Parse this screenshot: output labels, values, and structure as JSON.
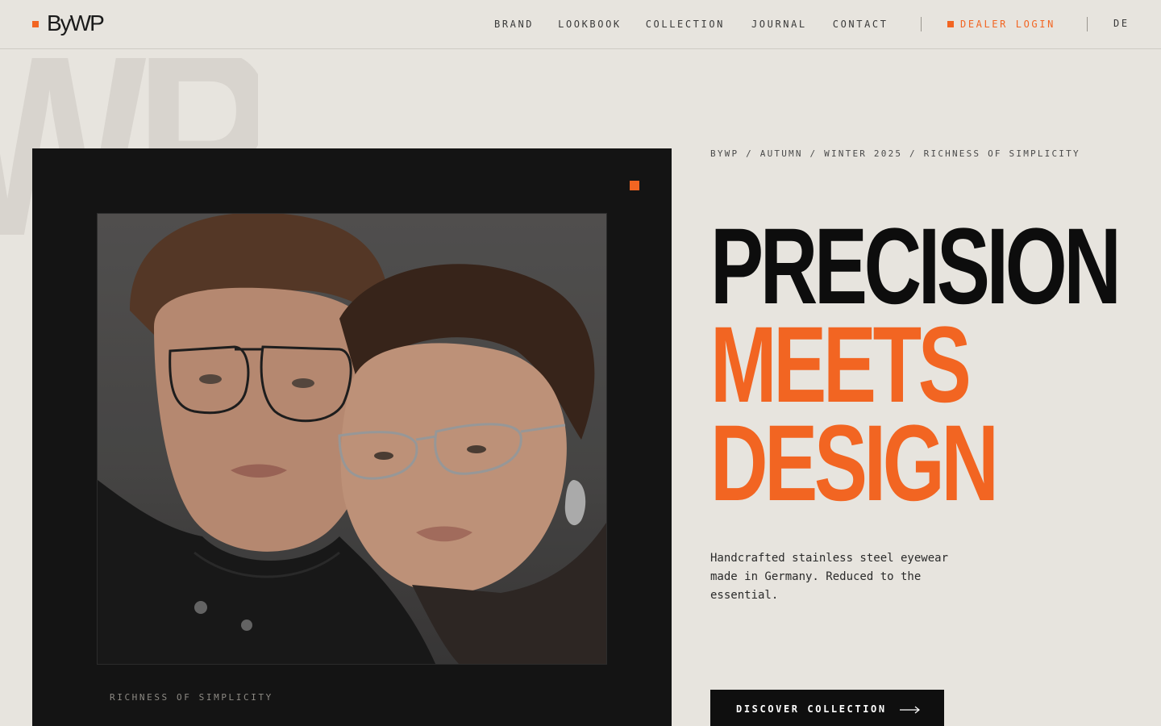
{
  "brand": {
    "logo_text": "ByWP"
  },
  "nav": {
    "items": [
      {
        "label": "BRAND"
      },
      {
        "label": "LOOKBOOK"
      },
      {
        "label": "COLLECTION"
      },
      {
        "label": "JOURNAL"
      },
      {
        "label": "CONTACT"
      }
    ],
    "dealer_login": "DEALER LOGIN",
    "language": "DE"
  },
  "background_mark": "WP",
  "hero_image": {
    "alt": "Man and woman wearing stainless steel eyeglasses",
    "caption": "RICHNESS OF SIMPLICITY"
  },
  "hero": {
    "breadcrumb": "BYWP / AUTUMN / WINTER 2025 / RICHNESS OF SIMPLICITY",
    "headline_line1": "PRECISION",
    "headline_line2": "MEETS",
    "headline_line3": "DESIGN",
    "description": "Handcrafted stainless steel eyewear made in Germany. Reduced to the essential.",
    "cta_label": "DISCOVER COLLECTION"
  },
  "icons": {
    "cta": "arrow-right-icon"
  },
  "colors": {
    "accent": "#f26522",
    "background": "#e7e4de",
    "panel": "#141414",
    "text": "#0d0d0d"
  }
}
